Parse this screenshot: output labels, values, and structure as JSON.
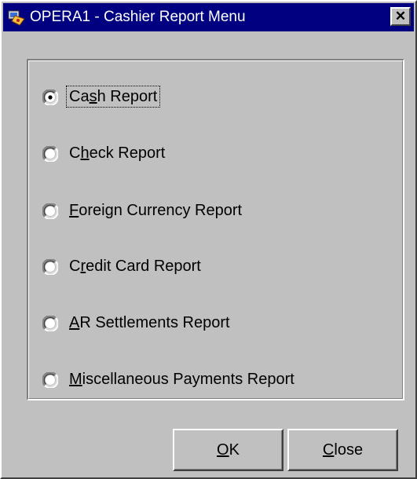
{
  "window": {
    "title": "OPERA1 - Cashier Report Menu",
    "close_label": "✕"
  },
  "options": [
    {
      "pre": "Ca",
      "key": "s",
      "post": "h Report",
      "selected": true
    },
    {
      "pre": "C",
      "key": "h",
      "post": "eck Report",
      "selected": false
    },
    {
      "pre": "",
      "key": "F",
      "post": "oreign Currency Report",
      "selected": false
    },
    {
      "pre": "C",
      "key": "r",
      "post": "edit Card Report",
      "selected": false
    },
    {
      "pre": "",
      "key": "A",
      "post": "R Settlements Report",
      "selected": false
    },
    {
      "pre": "",
      "key": "M",
      "post": "iscellaneous Payments Report",
      "selected": false
    }
  ],
  "buttons": {
    "ok": {
      "pre": "",
      "key": "O",
      "post": "K"
    },
    "close": {
      "pre": "",
      "key": "C",
      "post": "lose"
    }
  },
  "colors": {
    "face": "#c0c0c0",
    "titlebar": "#000080",
    "title_text": "#ffffff"
  },
  "icons": {
    "app": "opera-app-icon",
    "close": "close-icon"
  }
}
